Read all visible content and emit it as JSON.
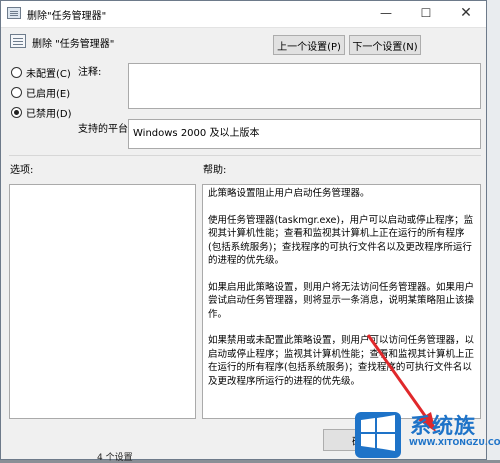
{
  "window": {
    "title": "删除\"任务管理器\"",
    "min_label": "—",
    "max_label": "☐",
    "close_label": "✕"
  },
  "policy": {
    "name": "删除 \"任务管理器\""
  },
  "nav": {
    "prev_label": "上一个设置(P)",
    "next_label": "下一个设置(N)"
  },
  "state_options": [
    {
      "label": "未配置(C)",
      "checked": false
    },
    {
      "label": "已启用(E)",
      "checked": false
    },
    {
      "label": "已禁用(D)",
      "checked": true
    }
  ],
  "comment": {
    "label": "注释:",
    "value": ""
  },
  "platform": {
    "label": "支持的平台:",
    "value": "Windows 2000 及以上版本"
  },
  "options": {
    "label": "选项:"
  },
  "help": {
    "label": "帮助:",
    "paragraphs": [
      "此策略设置阻止用户启动任务管理器。",
      "使用任务管理器(taskmgr.exe)，用户可以启动或停止程序；监视其计算机性能；查看和监视其计算机上正在运行的所有程序(包括系统服务)；查找程序的可执行文件名以及更改程序所运行的进程的优先级。",
      "如果启用此策略设置，则用户将无法访问任务管理器。如果用户尝试启动任务管理器，则将显示一条消息，说明某策略阻止该操作。",
      "如果禁用或未配置此策略设置，则用户可以访问任务管理器，以启动或停止程序；监视其计算机性能；查看和监视其计算机上正在运行的所有程序(包括系统服务)；查找程序的可执行文件名以及更改程序所运行的进程的优先级。"
    ]
  },
  "footer": {
    "ok_label": "确定",
    "status_text": "4 个设置"
  },
  "watermark": {
    "brand": "系统族",
    "url": "WWW.XITONGZU.COM",
    "accent": "#1e73c8"
  },
  "arrow_color": "#e0282b"
}
